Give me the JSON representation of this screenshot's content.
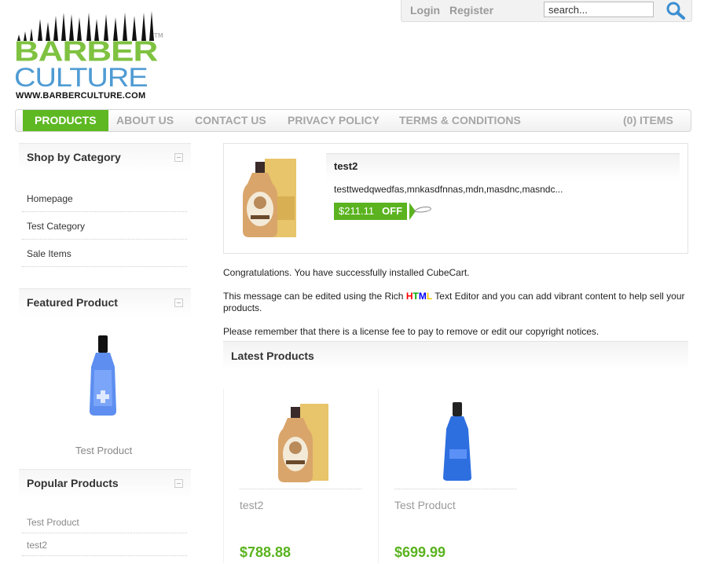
{
  "logo": {
    "word1": "BARBER",
    "word2": "CULTURE",
    "url": "WWW.BARBERCULTURE.COM",
    "tm": "TM"
  },
  "account": {
    "login": "Login",
    "register": "Register",
    "search_placeholder": "search..."
  },
  "nav": {
    "items": [
      "PRODUCTS",
      "ABOUT US",
      "CONTACT US",
      "PRIVACY POLICY",
      "TERMS & CONDITIONS"
    ],
    "basket": "(0) ITEMS"
  },
  "sidebar": {
    "shop_by_category": {
      "title": "Shop by Category",
      "links": [
        "Homepage",
        "Test Category",
        "Sale Items"
      ]
    },
    "featured": {
      "title": "Featured Product",
      "product_name": "Test Product"
    },
    "popular": {
      "title": "Popular Products",
      "links": [
        "Test Product",
        "test2"
      ]
    }
  },
  "feature": {
    "title": "test2",
    "description": "testtwedqwedfas,mnkasdfnnas,mdn,masdnc,masndc...",
    "price": "$211.11",
    "off_label": "OFF"
  },
  "content": {
    "p1": "Congratulations. You have successfully installed CubeCart.",
    "p2_before": "This message can be edited using the Rich ",
    "p2_html": [
      "H",
      "T",
      "M",
      "L"
    ],
    "p2_after": " Text Editor and you can add vibrant content to help sell your products.",
    "p3": "Please remember that there is a license fee to pay to remove or edit our copyright notices."
  },
  "latest": {
    "title": "Latest Products",
    "products": [
      {
        "name": "test2",
        "price": "$788.88"
      },
      {
        "name": "Test Product",
        "price": "$699.99"
      }
    ]
  },
  "colors": {
    "accent": "#5ab31f",
    "logo_green": "#7fc241",
    "logo_blue": "#4f9bd3",
    "html_colors": [
      "#ff0000",
      "#00aa00",
      "#0000ff",
      "#ffcc00"
    ]
  }
}
